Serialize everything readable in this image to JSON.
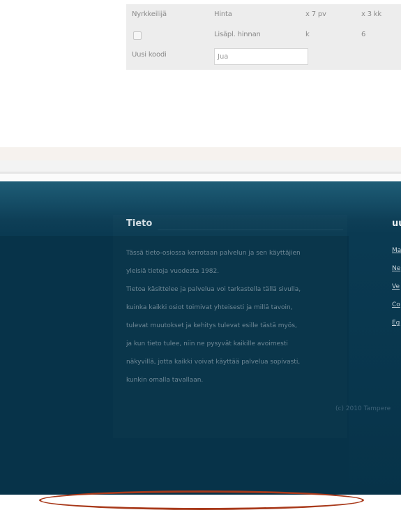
{
  "table": {
    "row1": {
      "label": "Nyrkkeilijä",
      "col2": "Hinta",
      "col3": "x 7 pv",
      "col4": "x 3 kk"
    },
    "row2": {
      "col2": "Lisäpl. hinnan",
      "col3": "k",
      "col4": "6"
    },
    "row3": {
      "label": "Uusi koodi",
      "input_value": "Jua"
    }
  },
  "footer": {
    "title": "Tieto",
    "paragraph": [
      "Tässä tieto-osiossa kerrotaan palvelun ja sen käyttäjien",
      "yleisiä tietoja vuodesta 1982.",
      "Tietoa käsittelee ja palvelua voi tarkastella tällä sivulla,",
      "kuinka kaikki osiot toimivat yhteisesti ja millä tavoin,",
      "tulevat muutokset ja kehitys tulevat esille tästä myös,",
      "ja kun tieto tulee, niin ne pysyvät kaikille avoimesti",
      "näkyvillä, jotta kaikki voivat käyttää palvelua sopivasti,",
      "kunkin omalla tavallaan."
    ],
    "side_title": "uu",
    "side_links": [
      "Ma",
      "Ne",
      "Ve",
      "Co",
      "Eg"
    ],
    "copyright": "(c) 2010 Tampere"
  },
  "colors": {
    "footer_bg": "#073349",
    "annotation": "#a8391a"
  }
}
